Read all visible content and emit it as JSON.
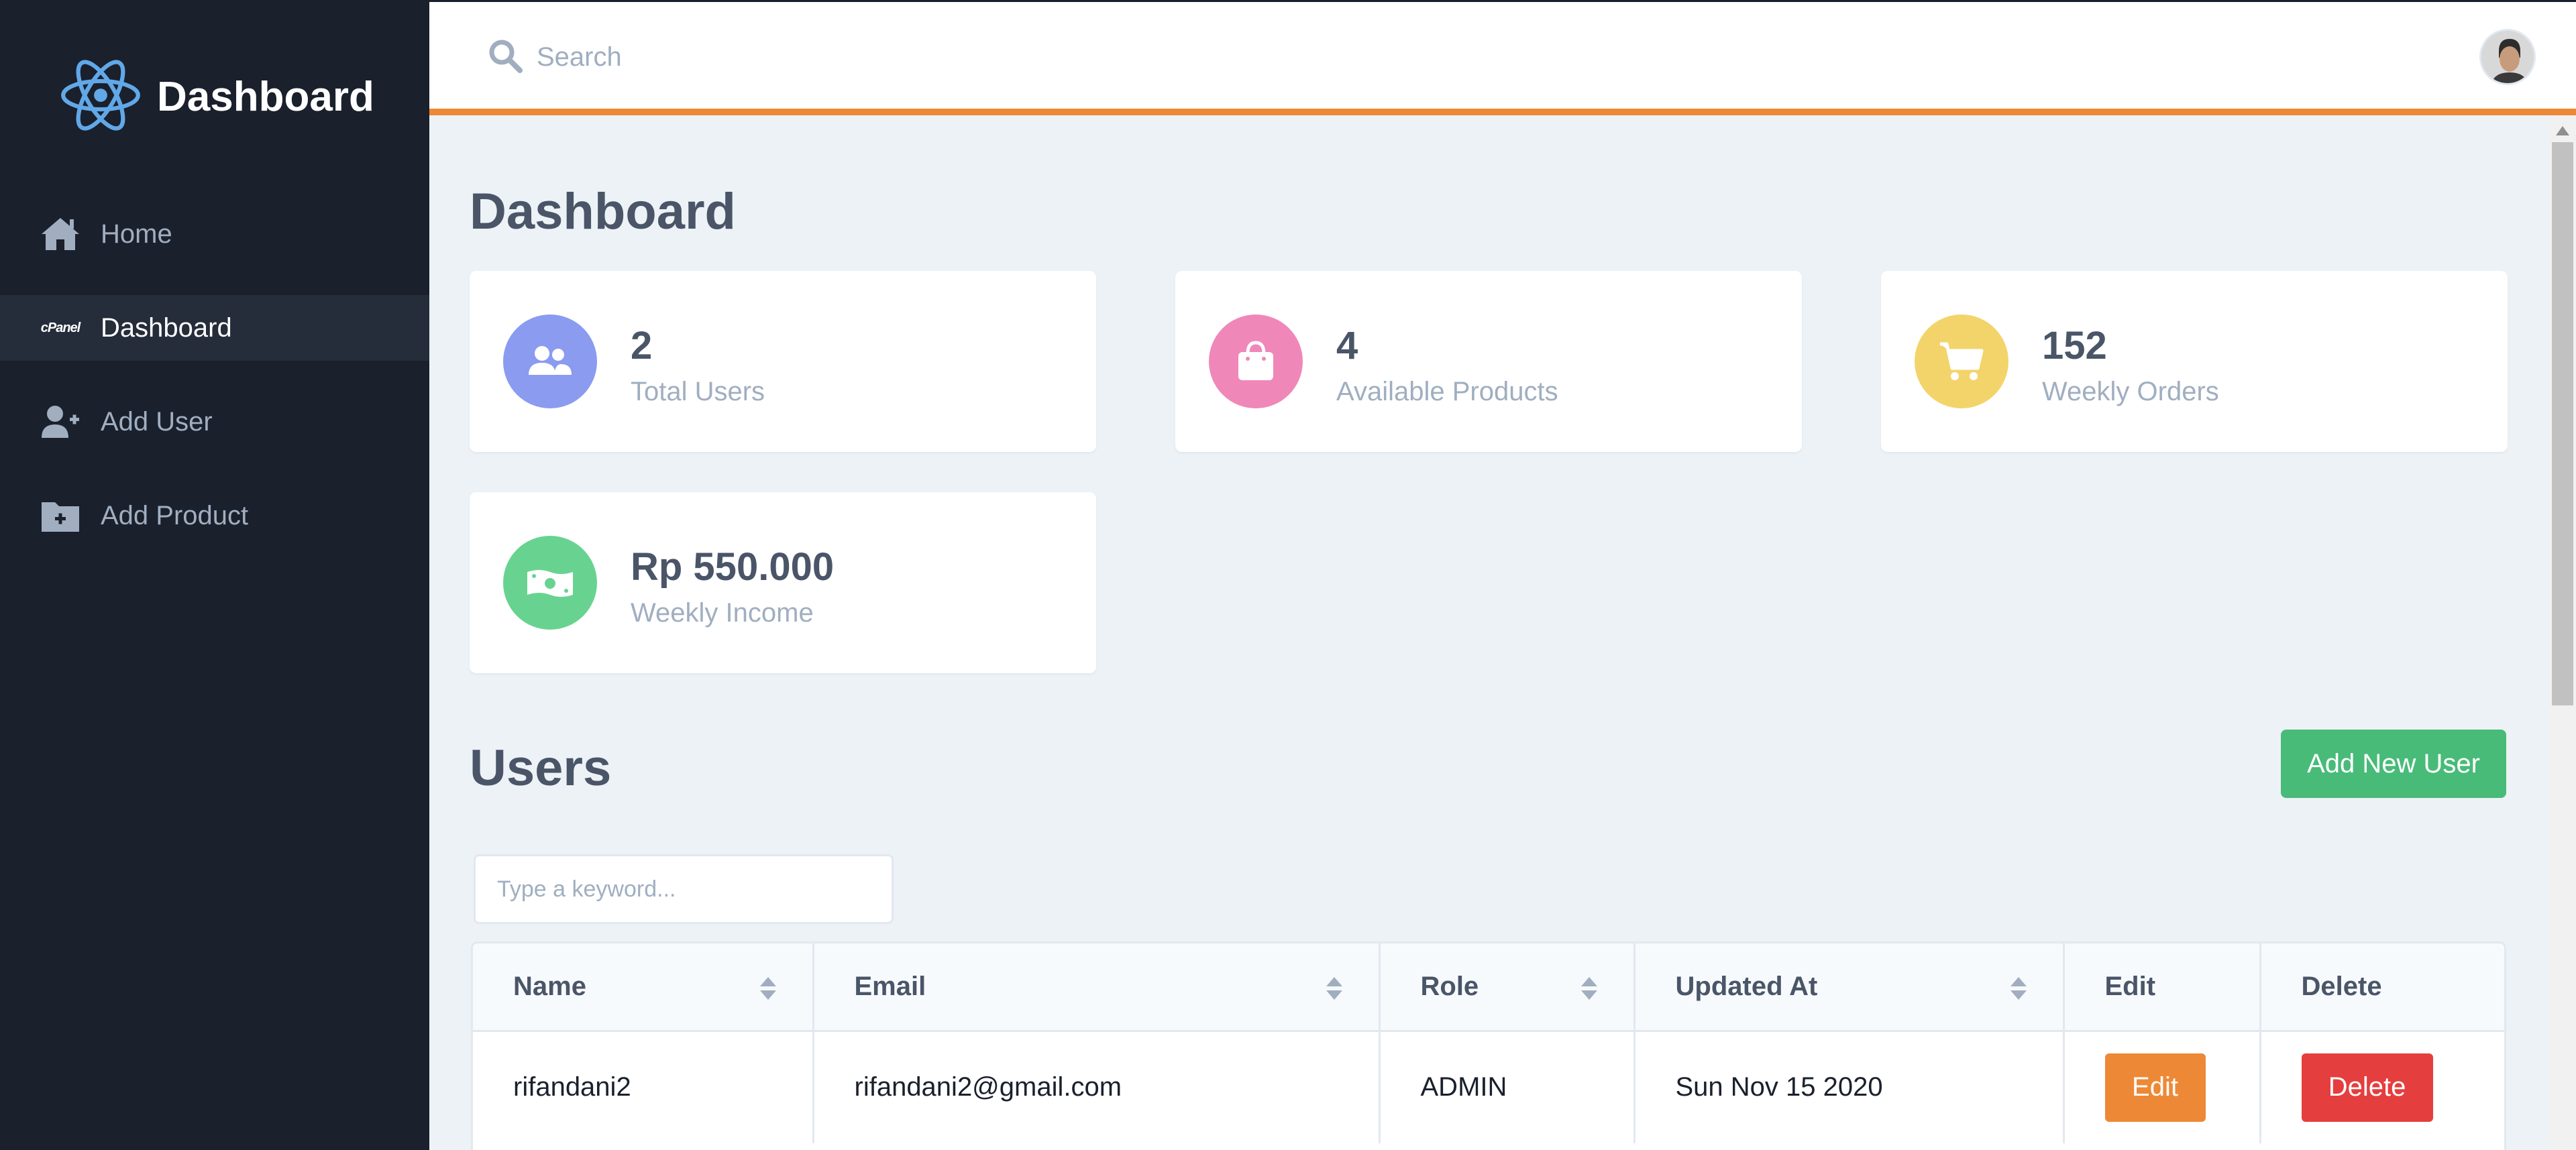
{
  "sidebar": {
    "brand_title": "Dashboard",
    "brand_icon": "react-atom-icon",
    "items": [
      {
        "label": "Home",
        "icon": "home-icon"
      },
      {
        "label": "Dashboard",
        "icon": "cpanel-icon",
        "icon_text": "cPanel",
        "active": true
      },
      {
        "label": "Add User",
        "icon": "user-plus-icon"
      },
      {
        "label": "Add Product",
        "icon": "folder-plus-icon"
      }
    ]
  },
  "header": {
    "search_placeholder": "Search",
    "accent_color": "#ed8936"
  },
  "main": {
    "title": "Dashboard",
    "stats": [
      {
        "value": "2",
        "label": "Total Users",
        "color": "#8a9bf0",
        "icon": "users-icon"
      },
      {
        "value": "4",
        "label": "Available Products",
        "color": "#f087b9",
        "icon": "shopping-bag-icon"
      },
      {
        "value": "152",
        "label": "Weekly Orders",
        "color": "#f3d46b",
        "icon": "cart-icon"
      },
      {
        "value": "Rp 550.000",
        "label": "Weekly Income",
        "color": "#68d391",
        "icon": "money-icon"
      }
    ],
    "users": {
      "title": "Users",
      "add_button": "Add New User",
      "keyword_placeholder": "Type a keyword...",
      "columns": [
        "Name",
        "Email",
        "Role",
        "Updated At",
        "Edit",
        "Delete"
      ],
      "rows": [
        {
          "name": "rifandani2",
          "email": "rifandani2@gmail.com",
          "role": "ADMIN",
          "updated_at": "Sun Nov 15 2020",
          "edit": "Edit",
          "delete": "Delete"
        }
      ]
    }
  }
}
